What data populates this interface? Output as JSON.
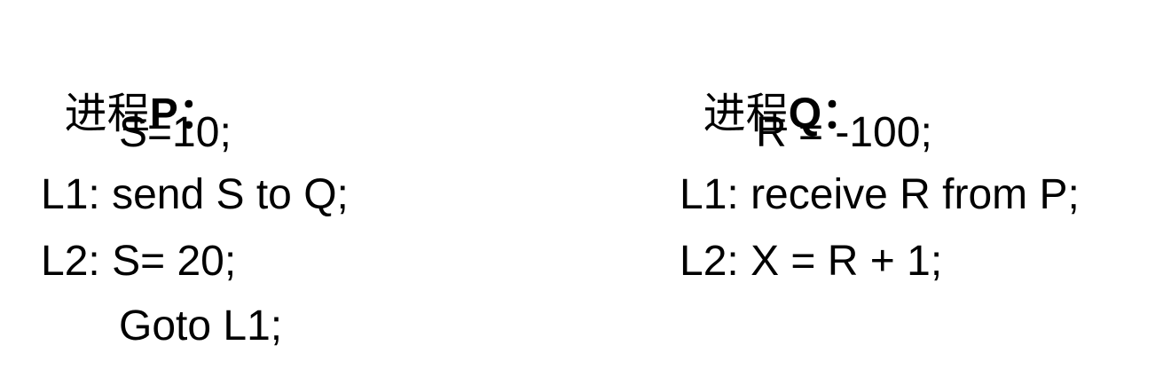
{
  "process_p": {
    "title_prefix": "进程",
    "title_name": "P",
    "title_colon": "：",
    "lines": [
      "S=10;",
      "L1: send S to Q;",
      "L2: S= 20;",
      "Goto L1;"
    ]
  },
  "process_q": {
    "title_prefix": "进程",
    "title_name": "Q",
    "title_colon": "：",
    "lines": [
      "R = -100;",
      "L1: receive R from P;",
      "L2: X = R + 1;"
    ]
  }
}
